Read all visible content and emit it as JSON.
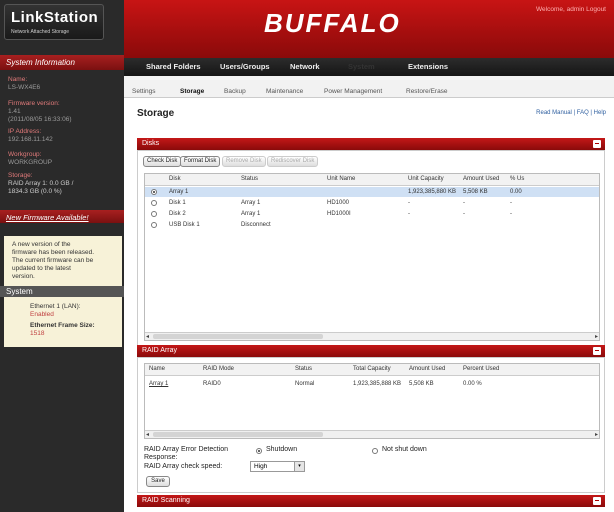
{
  "sidebar": {
    "logo_title": "LinkStation",
    "logo_subtitle": "Network Attached Storage",
    "info_header": "System Information",
    "name_label": "Name:",
    "name_value": "LS-WX4E6",
    "firmware_label": "Firmware version:",
    "firmware_value1": "1.41",
    "firmware_value2": "(2011/08/05 16:33:06)",
    "ip_label": "IP Address:",
    "ip_value": "192.168.11.142",
    "workgroup_label": "Workgroup:",
    "workgroup_value": "WORKGROUP",
    "storage_label": "Storage:",
    "storage_value1": "RAID Array 1: 0.0 GB /",
    "storage_value2": "1834.3 GB (0.0 %)",
    "new_fw_header": "New Firmware Available!",
    "new_fw_text": [
      "A new version of the",
      "firmware has been released.",
      "The current firmware can be",
      "updated to the latest",
      "version."
    ],
    "system_header": "System",
    "ethernet_label": "Ethernet 1 (LAN):",
    "ethernet_value": "Enabled",
    "frame_label": "Ethernet Frame Size:",
    "frame_value": "1518"
  },
  "header": {
    "brand": "BUFFALO",
    "welcome": "Welcome, admin Logout"
  },
  "topnav": [
    "Shared Folders",
    "Users/Groups",
    "Network",
    "System",
    "Extensions"
  ],
  "subnav": [
    "Settings",
    "Storage",
    "Backup",
    "Maintenance",
    "Power Management",
    "Restore/Erase"
  ],
  "main": {
    "title": "Storage",
    "help_links": "Read Manual | FAQ | Help"
  },
  "disks": {
    "header": "Disks",
    "buttons": [
      "Check Disk",
      "Format Disk",
      "Remove Disk",
      "Rediscover Disk"
    ],
    "columns": [
      "Disk",
      "Status",
      "Unit Name",
      "Unit Capacity",
      "Amount Used",
      "% Us"
    ],
    "rows": [
      {
        "disk": "Array 1",
        "status": "",
        "unit": "",
        "capacity": "1,923,385,880 KB",
        "used": "5,508 KB",
        "pct": "0.00"
      },
      {
        "disk": "Disk 1",
        "status": "Array 1",
        "unit": "HD1000",
        "capacity": "-",
        "used": "-",
        "pct": "-"
      },
      {
        "disk": "Disk 2",
        "status": "Array 1",
        "unit": "HD1000I",
        "capacity": "-",
        "used": "-",
        "pct": "-"
      },
      {
        "disk": "USB Disk 1",
        "status": "Disconnect",
        "unit": "",
        "capacity": "",
        "used": "",
        "pct": ""
      }
    ]
  },
  "raid": {
    "header": "RAID Array",
    "columns": [
      "Name",
      "RAID Mode",
      "Status",
      "Total Capacity",
      "Amount Used",
      "Percent Used"
    ],
    "rows": [
      {
        "name": "Array 1",
        "mode": "RAID0",
        "status": "Normal",
        "total": "1,923,385,888 KB",
        "used": "5,508 KB",
        "pct": "0.00 %"
      }
    ],
    "error_label": "RAID Array Error Detection Response:",
    "error_opt1": "Shutdown",
    "error_opt2": "Not shut down",
    "speed_label": "RAID Array check speed:",
    "speed_value": "High",
    "save_label": "Save"
  },
  "scanning": {
    "header": "RAID Scanning"
  }
}
